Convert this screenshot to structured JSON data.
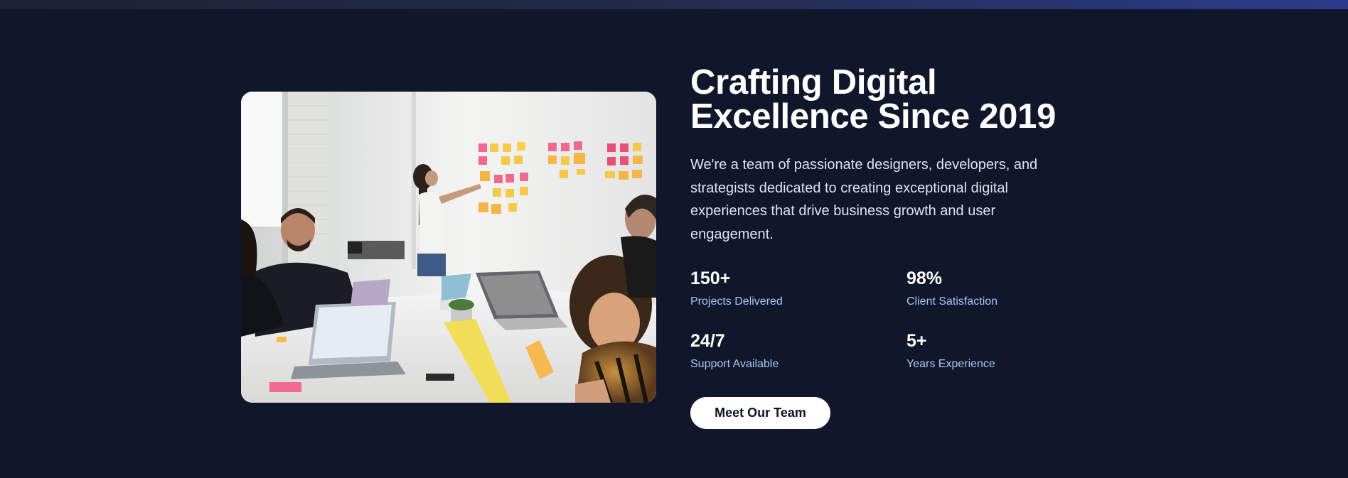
{
  "about": {
    "image_alt": "Team collaborating in a meeting room with sticky notes on a whiteboard",
    "headline_line1": "Crafting Digital",
    "headline_line2": "Excellence Since 2019",
    "description": "We're a team of passionate designers, developers, and strategists dedicated to creating exceptional digital experiences that drive business growth and user engagement.",
    "stats": [
      {
        "value": "150+",
        "label": "Projects Delivered"
      },
      {
        "value": "98%",
        "label": "Client Satisfaction"
      },
      {
        "value": "24/7",
        "label": "Support Available"
      },
      {
        "value": "5+",
        "label": "Years Experience"
      }
    ],
    "cta_label": "Meet Our Team"
  },
  "colors": {
    "page_background": "#11172a",
    "heading": "#ffffff",
    "description": "#dde3f1",
    "stat_label": "#a9c4f5",
    "button_background": "#ffffff",
    "button_text": "#0d1324",
    "top_accent_end": "#2c3b8a"
  }
}
